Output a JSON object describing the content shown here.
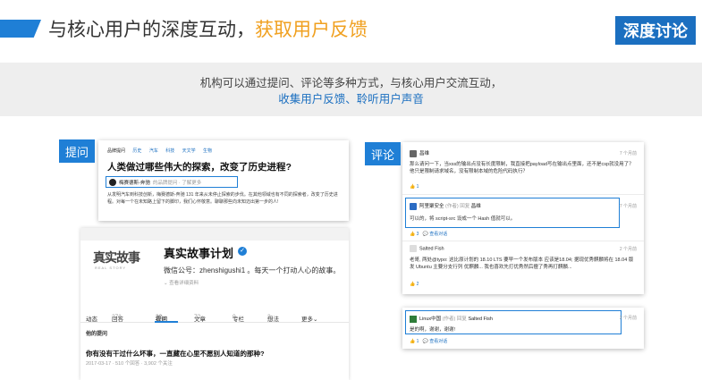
{
  "header": {
    "title": "与核心用户的深度互动，",
    "title_highlight": "获取用户反馈",
    "badge": "深度讨论"
  },
  "banner": {
    "line1": "机构可以通过提问、评论等多种方式，与核心用户交流互动，",
    "line2": "收集用户反馈、聆听用户声音"
  },
  "colors": {
    "accent": "#1f7fd6",
    "highlight": "#f0a01f",
    "badge_bg": "#1b6fc0"
  },
  "left_tag": "提问",
  "right_tag": "评论",
  "question_card": {
    "categories": [
      "品牌提问",
      "历史",
      "汽车",
      "科技",
      "天文学",
      "生物"
    ],
    "question": "人类做过哪些伟大的探索，改变了历史进程?",
    "author": "梅赛德斯-奔驰",
    "author_sub": "的品牌提问 · 了解更多",
    "body": "从发明汽车到科技创新，梅赛德斯-奔驰 131 年来从未停止探索的步伐。在其他领域也有不同的探索者，改变了历史进程。对每一个在未知路上留下的脚印，我们心怀敬意。聊聊那些向未知迈出第一步的人!"
  },
  "profile_card": {
    "logo": "真实故事",
    "logo_sub": "REAL STORY",
    "name": "真实故事计划",
    "verified_icon": "check-icon",
    "desc": "微信公号：zhenshigushi1 。每天一个打动人心的故事。",
    "more": "⌄ 查看详细资料",
    "tabs": [
      {
        "label": "动态",
        "count": ""
      },
      {
        "label": "回答",
        "count": "271"
      },
      {
        "label": "提问",
        "count": "22"
      },
      {
        "label": "文章",
        "count": "72"
      },
      {
        "label": "专栏",
        "count": "0"
      },
      {
        "label": "想法",
        "count": "2"
      },
      {
        "label": "更多⌄",
        "count": ""
      }
    ],
    "section": "他的提问",
    "q_title": "你有没有干过什么坏事，一直藏在心里不愿别人知道的那种?",
    "q_meta": "2017-03-17 · 510 个回答 · 3,902 个关注"
  },
  "comments": [
    {
      "user": "昌维",
      "time": "7 个月前",
      "text": "那么请问一下，当xss的输出点没有长度限制，我直接把payload写在输出点里面，还不是csp就没用了？他只是限制请求域名，没有限制本域的危险代码执行？",
      "likes": "1"
    },
    {
      "user": "阿里聚安全",
      "role": "(作者)",
      "reply_word": "回复",
      "reply_to": "昌维",
      "time": "7 个月前",
      "text": "可以的，将 script-src 设成一个 Hash 值就可以。",
      "likes": "3",
      "action": "查看对话"
    },
    {
      "user": "Salted Fish",
      "time": "2 个月前",
      "text": "老哥, 两处@typo: 这比原计划的 18.10 LTS 要早一个发布版本 应该是18.04; 据现优秀麒麟将在 18.04 版发 Ubuntu 主要分支行列 优麒麟... 我也喜欢先打优秀然后擅了秀再打麒麟...",
      "likes": "2"
    }
  ],
  "reply_comment": {
    "user": "Linux中国",
    "role": "(作者)",
    "reply_word": "回复",
    "reply_to": "Salted Fish",
    "time": "2 个月前",
    "text": "是的啊，谢谢，谢谢!",
    "likes": "1",
    "action": "查看对话"
  }
}
